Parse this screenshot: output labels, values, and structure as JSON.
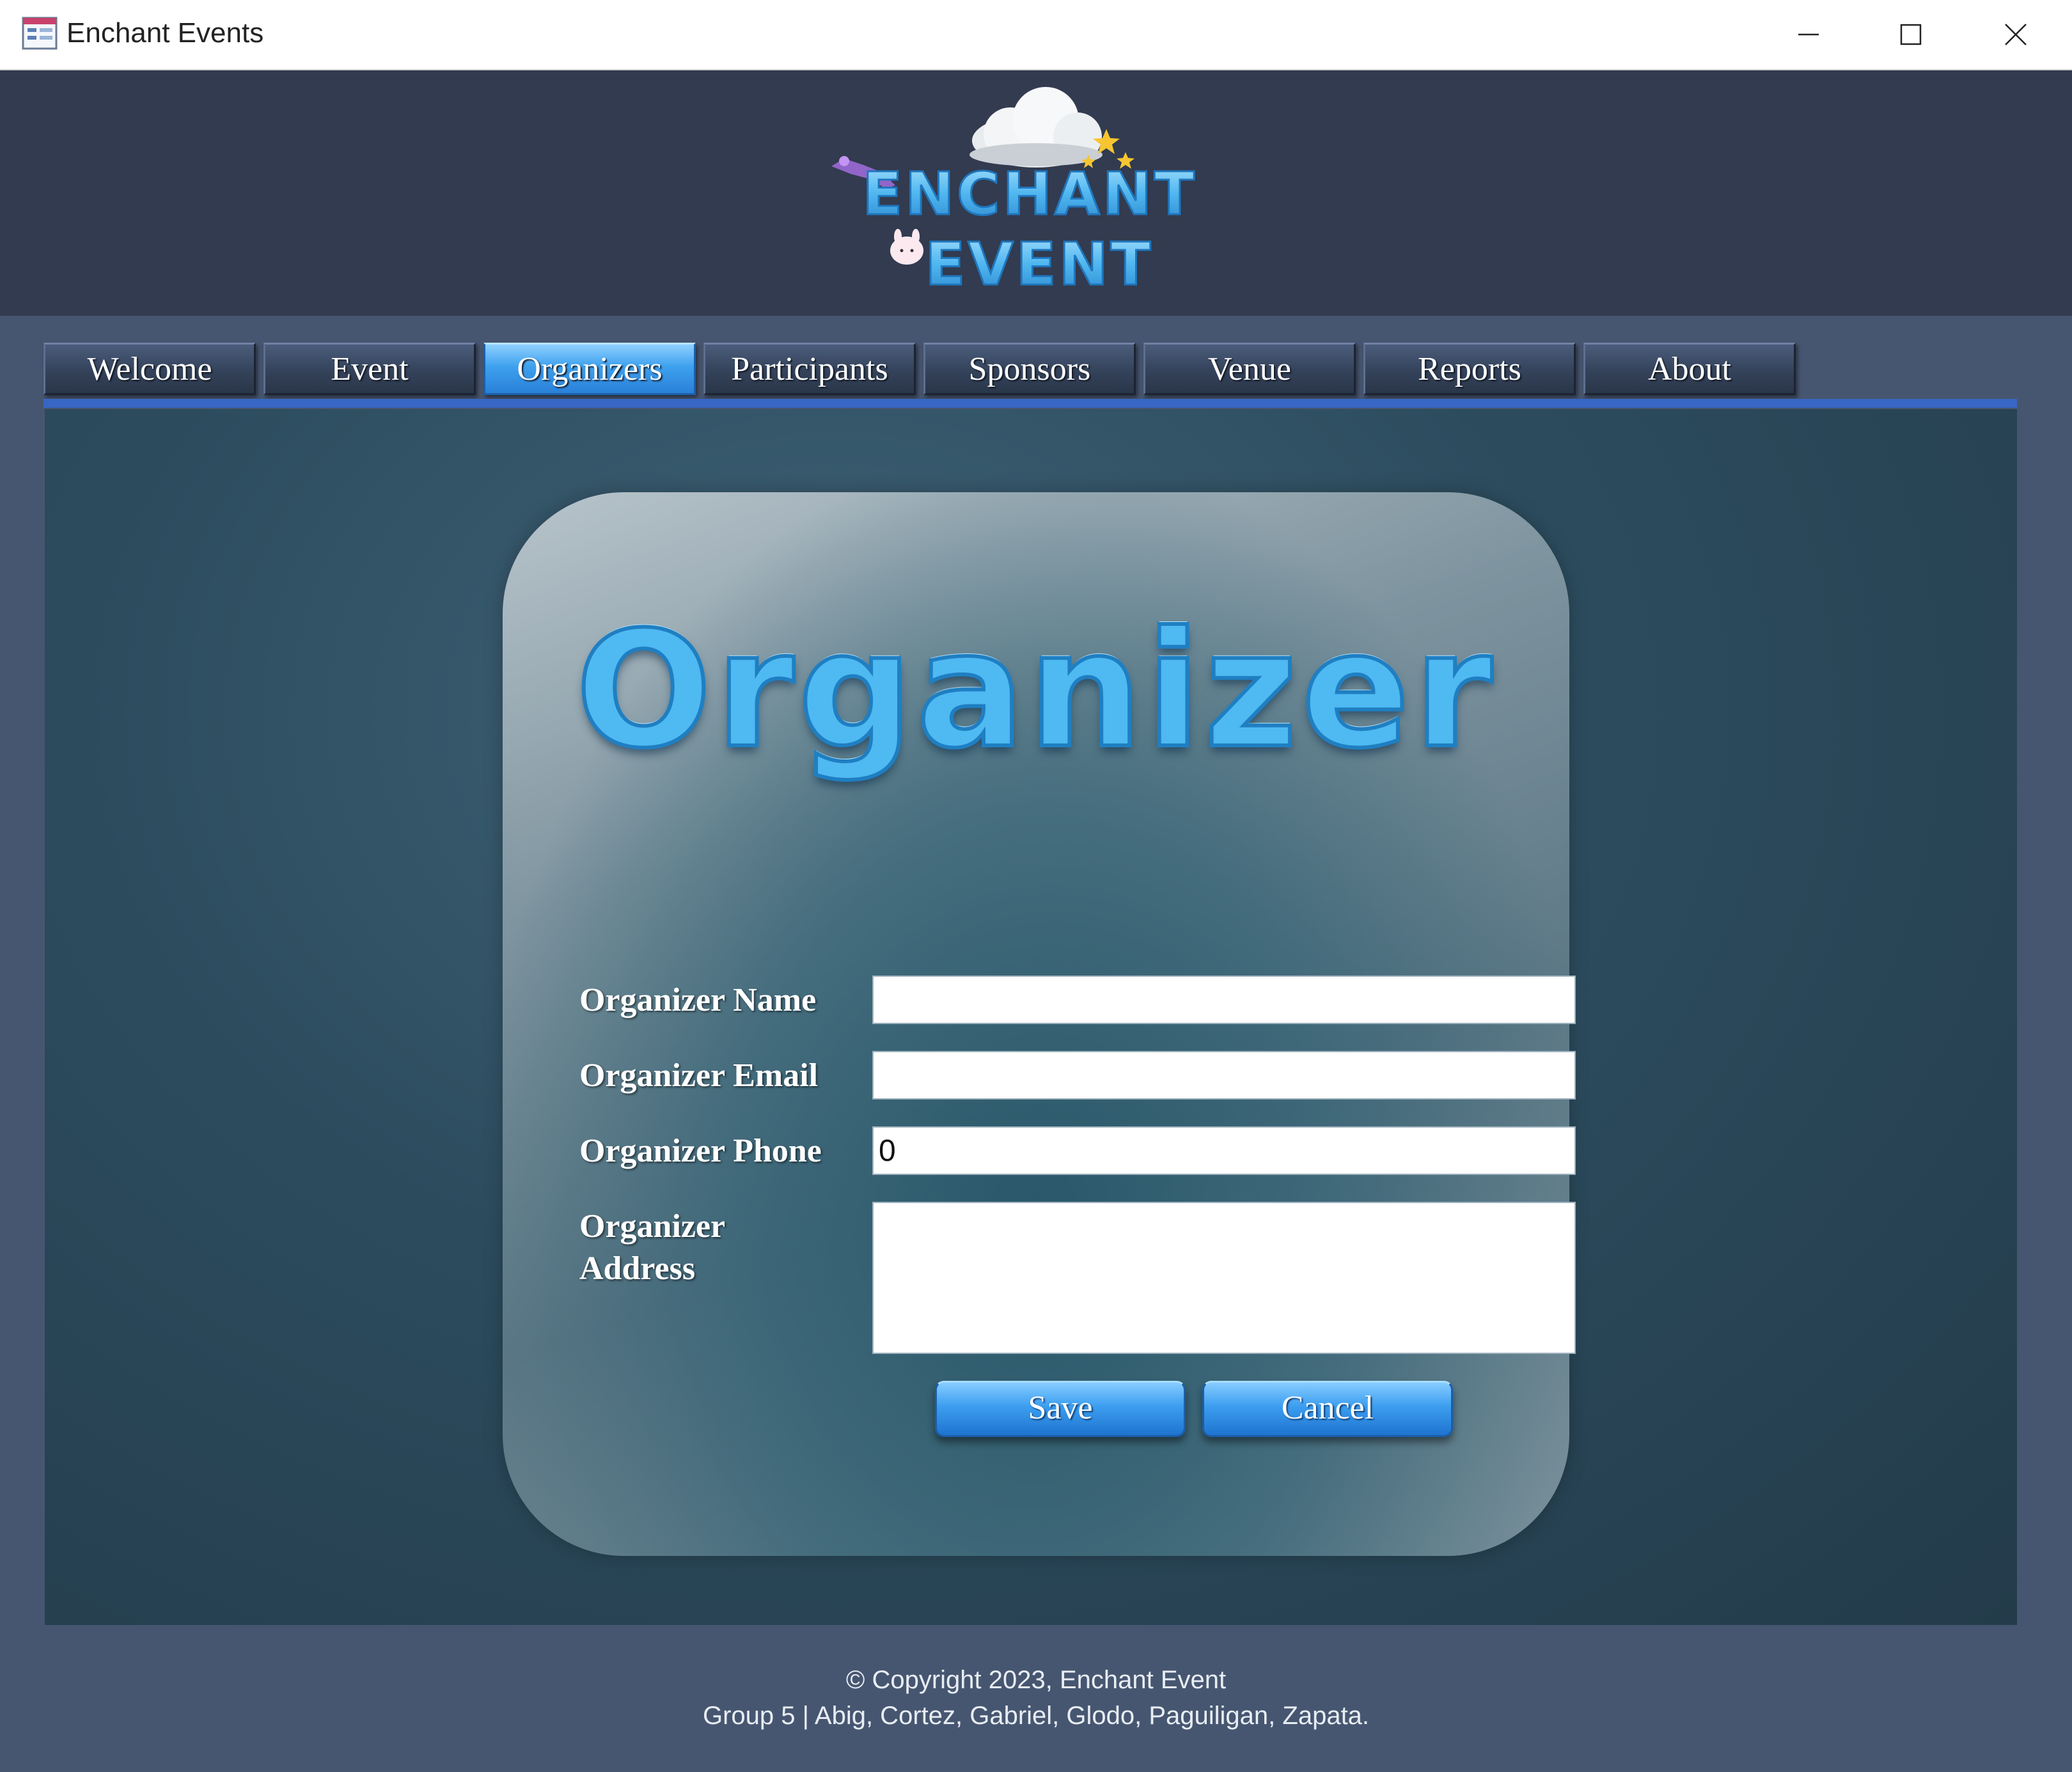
{
  "window": {
    "title": "Enchant Events",
    "controls": [
      "minimize-icon",
      "maximize-icon",
      "close-icon"
    ]
  },
  "header": {
    "logo_text_line1": "Enchant",
    "logo_text_line2": "Event"
  },
  "tabs": [
    {
      "label": "Welcome",
      "active": false
    },
    {
      "label": "Event",
      "active": false
    },
    {
      "label": "Organizers",
      "active": true
    },
    {
      "label": "Participants",
      "active": false
    },
    {
      "label": "Sponsors",
      "active": false
    },
    {
      "label": "Venue",
      "active": false
    },
    {
      "label": "Reports",
      "active": false
    },
    {
      "label": "About",
      "active": false
    }
  ],
  "form": {
    "heading": "Organizer",
    "fields": {
      "name": {
        "label": "Organizer Name",
        "value": ""
      },
      "email": {
        "label": "Organizer Email",
        "value": ""
      },
      "phone": {
        "label": "Organizer Phone",
        "value": "0"
      },
      "address": {
        "label_line1": "Organizer",
        "label_line2": "Address",
        "value": ""
      }
    },
    "buttons": {
      "save": "Save",
      "cancel": "Cancel"
    }
  },
  "footer": {
    "line1": "© Copyright 2023, Enchant Event",
    "line2": "Group 5 | Abig, Cortez, Gabriel, Glodo, Paguiligan, Zapata."
  },
  "colors": {
    "header_bg": "#323b4f",
    "body_bg": "#475670",
    "tab_active": "#3ea1ee",
    "tab_underline": "#3866c4",
    "heading_blue": "#4fb9f2"
  }
}
